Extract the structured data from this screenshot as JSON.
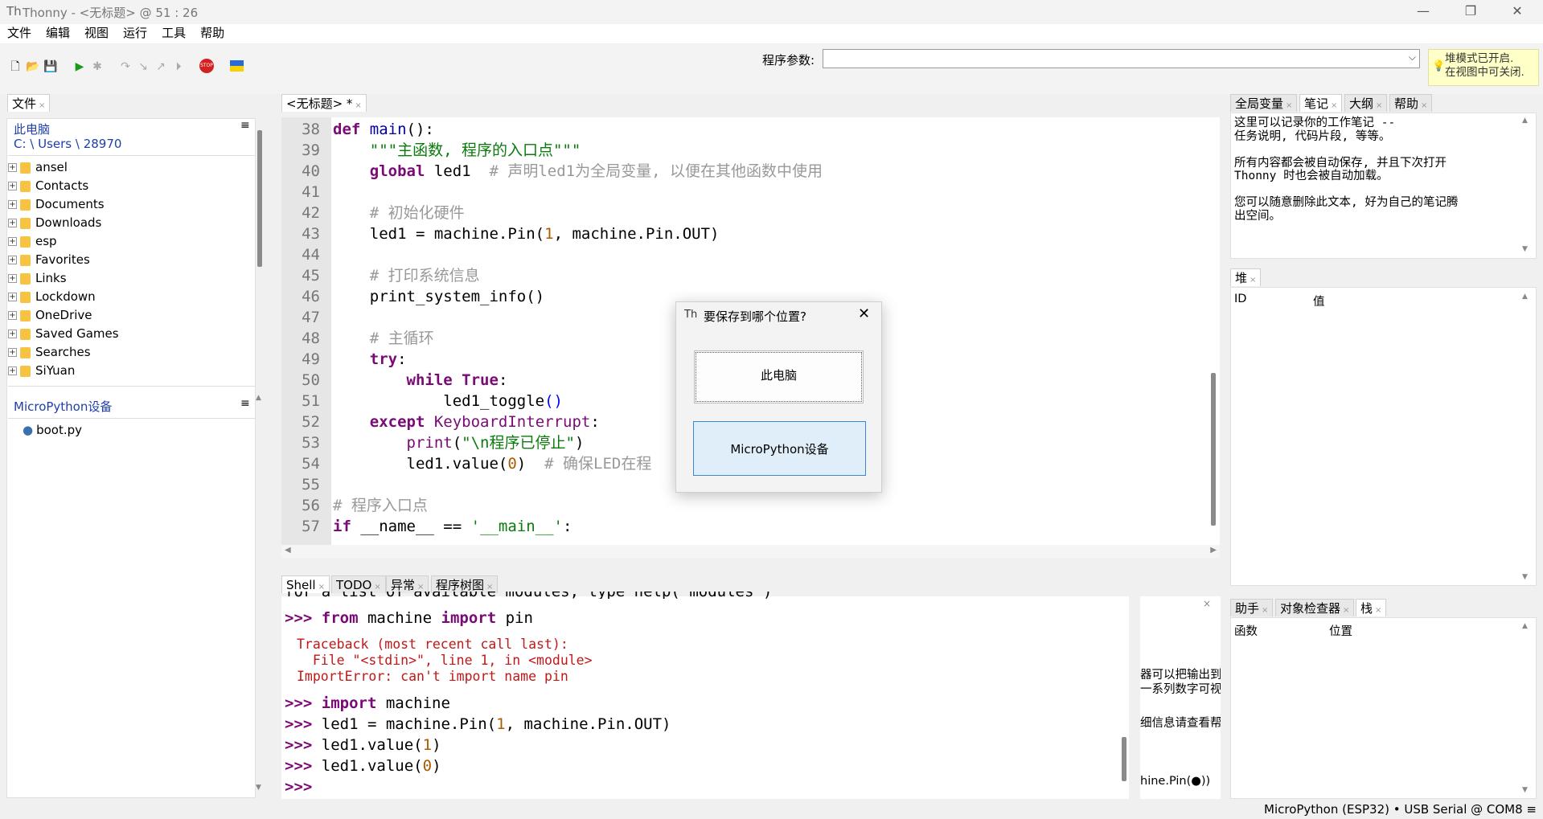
{
  "window": {
    "title": "Thonny  -  <无标题>  @  51 : 26"
  },
  "menu": [
    "文件",
    "编辑",
    "视图",
    "运行",
    "工具",
    "帮助"
  ],
  "toolbar": {
    "args_label": "程序参数:",
    "args_value": "",
    "heap_note_line1": "堆模式已开启.",
    "heap_note_line2": "在视图中可关闭."
  },
  "files_panel": {
    "tab": "文件",
    "computer_title": "此电脑",
    "path": "C: \\ Users \\ 28970",
    "folders": [
      "ansel",
      "Contacts",
      "Documents",
      "Downloads",
      "esp",
      "Favorites",
      "Links",
      "Lockdown",
      "OneDrive",
      "Saved Games",
      "Searches",
      "SiYuan"
    ],
    "device_title": "MicroPython设备",
    "device_files": [
      "boot.py"
    ]
  },
  "editor": {
    "tab": "<无标题> *",
    "line_numbers": [
      "38",
      "39",
      "40",
      "41",
      "42",
      "43",
      "44",
      "45",
      "46",
      "47",
      "48",
      "49",
      "50",
      "51",
      "52",
      "53",
      "54",
      "55",
      "56",
      "57"
    ]
  },
  "shell": {
    "tabs": [
      "Shell",
      "TODO",
      "异常",
      "程序树图"
    ],
    "partial_top": "for a list of available modules, type help('modules')",
    "errors": [
      "Traceback (most recent call last):",
      "  File \"<stdin>\", line 1, in <module>",
      "ImportError: can't import name pin"
    ],
    "prompt": ">>>",
    "commands_tail": [
      "import machine",
      "led1 = machine.Pin(1, machine.Pin.OUT)",
      "led1.value(1)",
      "led1.value(0)"
    ],
    "side_snips": [
      "器可以把输出到",
      "一系列数字可视",
      "细信息请查看帮助",
      "hine.Pin(●))"
    ]
  },
  "right_top": {
    "tabs": [
      "全局变量",
      "笔记",
      "大纲",
      "帮助"
    ],
    "notes": [
      "这里可以记录你的工作笔记 --",
      "任务说明, 代码片段, 等等。",
      "",
      "所有内容都会被自动保存, 并且下次打开",
      "Thonny 时也会被自动加载。",
      "",
      "您可以随意删除此文本, 好为自己的笔记腾",
      "出空间。"
    ]
  },
  "heap": {
    "tab": "堆",
    "col_id": "ID",
    "col_val": "值"
  },
  "stack": {
    "tabs": [
      "助手",
      "对象检查器",
      "栈"
    ],
    "col_func": "函数",
    "col_pos": "位置"
  },
  "dialog": {
    "title": "要保存到哪个位置?",
    "btn_computer": "此电脑",
    "btn_device": "MicroPython设备"
  },
  "status": "MicroPython (ESP32)  •  USB Serial @ COM8  ≡",
  "colors": {
    "keyword": "#7a0a76",
    "string": "#0a7a0a",
    "comment": "#999999",
    "number": "#ad5a00",
    "error": "#c01818"
  }
}
